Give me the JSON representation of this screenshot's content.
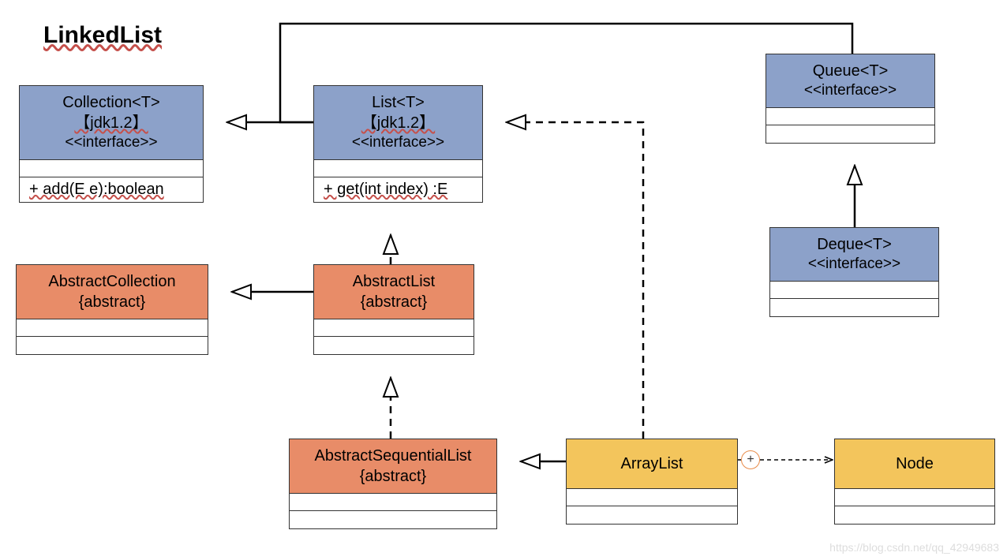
{
  "title": "LinkedList",
  "boxes": {
    "collection": {
      "name": "Collection<T>",
      "version": "【jdk1.2】",
      "stereo": "<<interface>>",
      "method": "+ add(E e):boolean"
    },
    "list": {
      "name": "List<T>",
      "version": "【jdk1.2】",
      "stereo": "<<interface>>",
      "method": "+ get(int index) :E"
    },
    "queue": {
      "name": "Queue<T>",
      "stereo": "<<interface>>"
    },
    "deque": {
      "name": "Deque<T>",
      "stereo": "<<interface>>"
    },
    "abscoll": {
      "name": "AbstractCollection",
      "mod": "{abstract}"
    },
    "abslist": {
      "name": "AbstractList",
      "mod": "{abstract}"
    },
    "absseq": {
      "name": "AbstractSequentialList",
      "mod": "{abstract}"
    },
    "arraylist": {
      "name": "ArrayList"
    },
    "node": {
      "name": "Node"
    }
  },
  "plus": "+",
  "watermark": "https://blog.csdn.net/qq_42949683"
}
